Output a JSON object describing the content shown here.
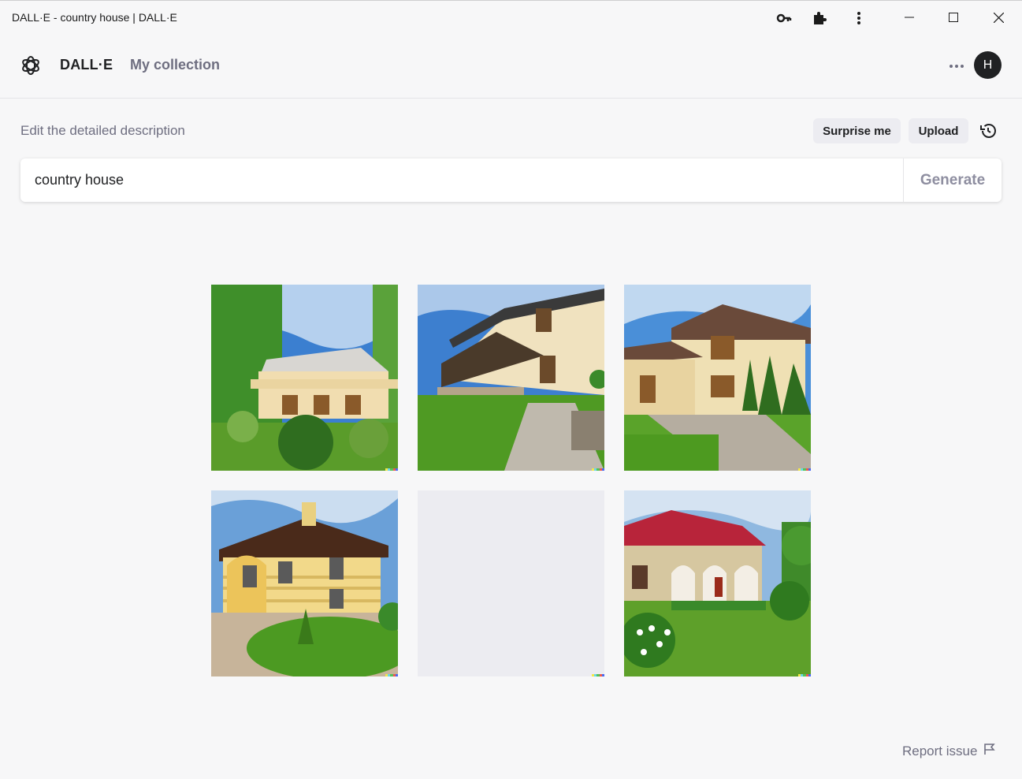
{
  "window": {
    "title": "DALL·E - country house | DALL·E"
  },
  "header": {
    "brand": "DALL·E",
    "nav_link": "My collection",
    "avatar_initial": "H"
  },
  "prompt": {
    "label": "Edit the detailed description",
    "surprise_label": "Surprise me",
    "upload_label": "Upload",
    "value": "country house",
    "generate_label": "Generate"
  },
  "results": [
    {
      "subject": "house-image",
      "state": "loaded"
    },
    {
      "subject": "house-image",
      "state": "loaded"
    },
    {
      "subject": "house-image",
      "state": "loaded"
    },
    {
      "subject": "house-image",
      "state": "loaded"
    },
    {
      "subject": "placeholder",
      "state": "empty"
    },
    {
      "subject": "house-image",
      "state": "loaded"
    }
  ],
  "footer": {
    "report_label": "Report issue"
  },
  "colors": {
    "text": "#202123",
    "muted": "#6e6e80",
    "pill_bg": "#ececf1",
    "background": "#f7f7f8"
  }
}
